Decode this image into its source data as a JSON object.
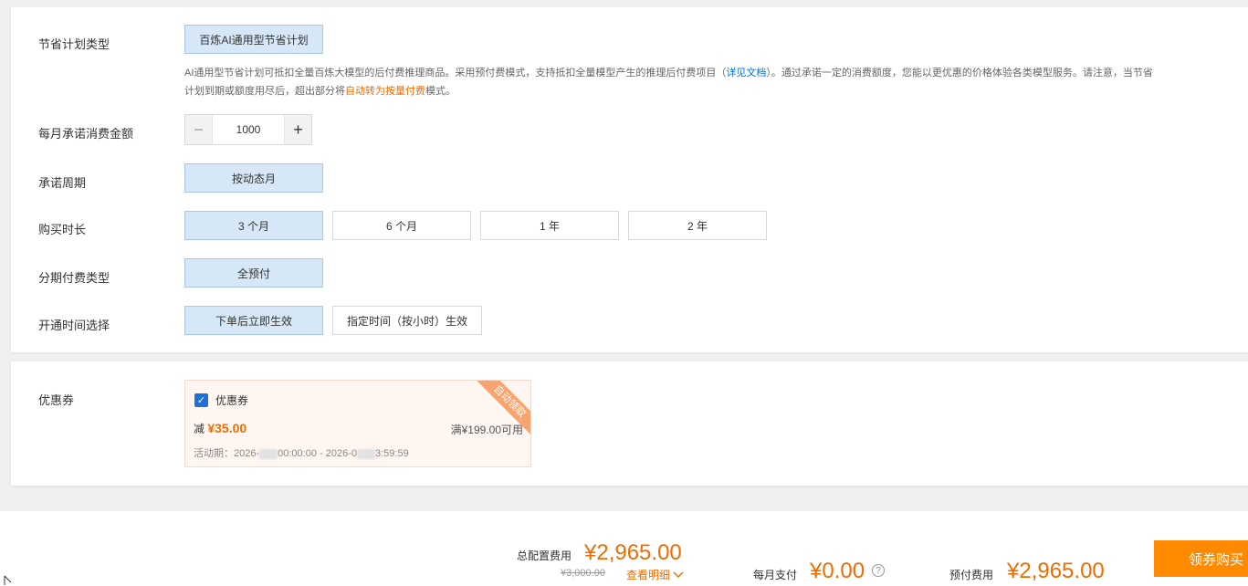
{
  "config": {
    "plan_type": {
      "label": "节省计划类型",
      "options": [
        "百炼AI通用型节省计划"
      ],
      "desc_part1": "AI通用型节省计划可抵扣全量百炼大模型的后付费推理商品。采用预付费模式，支持抵扣全量模型产生的推理后付费项目（",
      "desc_link": "详见文档",
      "desc_part2": "）。通过承诺一定的消费额度，您能以更优惠的价格体验各类模型服务。请注意，当节省",
      "desc_part3": "计划到期或额度用尽后，超出部分将",
      "desc_orange": "自动转为按量付费",
      "desc_part4": "模式。"
    },
    "monthly_amount": {
      "label": "每月承诺消费金额",
      "value": "1000",
      "minus": "−",
      "plus": "+"
    },
    "period": {
      "label": "承诺周期",
      "options": [
        "按动态月"
      ]
    },
    "duration": {
      "label": "购买时长",
      "options": [
        "3 个月",
        "6 个月",
        "1 年",
        "2 年"
      ],
      "selected": "3 个月"
    },
    "payment_type": {
      "label": "分期付费类型",
      "options": [
        "全预付"
      ]
    },
    "activation": {
      "label": "开通时间选择",
      "options": [
        "下单后立即生效",
        "指定时间（按小时）生效"
      ],
      "selected": "下单后立即生效"
    }
  },
  "coupon": {
    "label": "优惠券",
    "name": "优惠券",
    "checked": true,
    "check_mark": "✓",
    "discount_prefix": "减",
    "discount": "¥35.00",
    "condition": "满¥199.00可用",
    "period_prefix": "活动期：2026-",
    "period_mid": "00:00:00 - 2026-0",
    "period_end": "3:59:59",
    "ribbon": "自动领取"
  },
  "footer": {
    "total_label": "总配置费用",
    "total_price": "¥2,965.00",
    "original_price": "¥3,000.00",
    "detail_link": "查看明细",
    "monthly_label": "每月支付",
    "monthly_price": "¥0.00",
    "help": "?",
    "prepay_label": "预付费用",
    "prepay_price": "¥2,965.00",
    "buy_button": "领券购买"
  },
  "colors": {
    "accent_orange": "#ed6d00",
    "selected_bg": "#d6e8f7",
    "link_blue": "#0070cc",
    "buy_button": "#ff8a00"
  }
}
